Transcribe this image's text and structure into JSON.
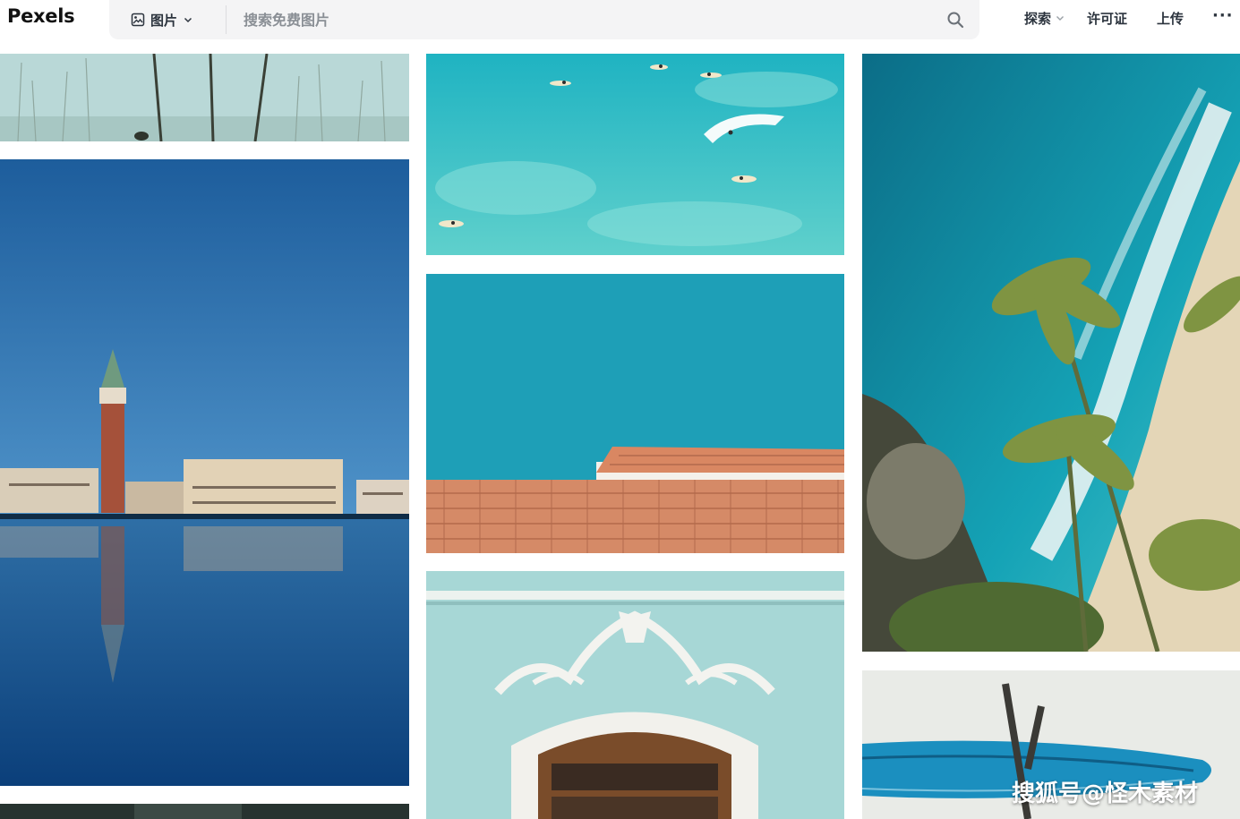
{
  "brand": {
    "name": "Pexels"
  },
  "search": {
    "media_type": "图片",
    "placeholder": "搜索免费图片",
    "value": ""
  },
  "nav": {
    "explore": "探索",
    "license": "许可证",
    "upload": "上传",
    "more": "···"
  },
  "icons": {
    "media_type": "image-icon",
    "dropdown": "chevron-down-icon",
    "search": "search-icon"
  },
  "watermark": "搜狐号@怪木素材",
  "colors": {
    "searchbar_bg": "#f4f4f5",
    "text": "#2c343e",
    "placeholder": "#8a8f95"
  }
}
